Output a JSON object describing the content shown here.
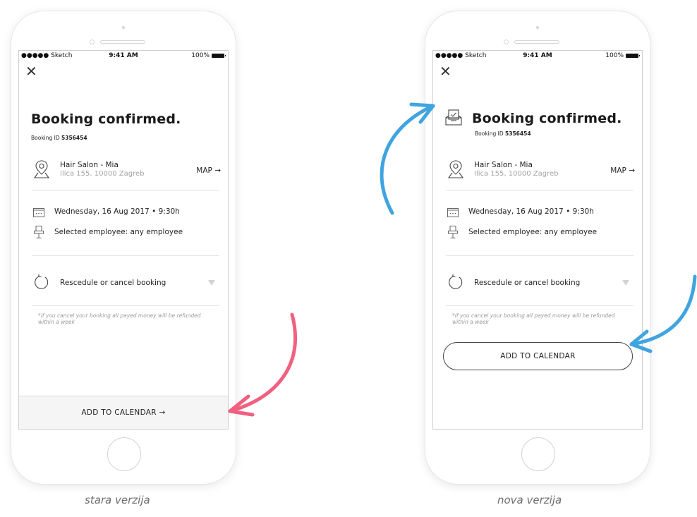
{
  "status_bar": {
    "carrier": "●●●●● Sketch",
    "time": "9:41 AM",
    "battery": "100%"
  },
  "old_version": {
    "title": "Booking confirmed.",
    "booking_id_label": "Booking ID",
    "booking_id": "5356454",
    "salon_name": "Hair Salon - Mia",
    "salon_address": "Ilica 155, 10000 Zagreb",
    "map_link": "MAP →",
    "date_time": "Wednesday, 16 Aug 2017 • 9:30h",
    "employee": "Selected employee: any employee",
    "reschedule": "Rescedule or cancel booking",
    "note": "*if you cancel your booking all payed money will be refunded within a week",
    "cta": "ADD TO CALENDAR →",
    "caption": "stara verzija"
  },
  "new_version": {
    "title": "Booking confirmed.",
    "booking_id_label": "Booking ID",
    "booking_id": "5356454",
    "salon_name": "Hair Salon - Mia",
    "salon_address": "Ilica 155, 10000 Zagreb",
    "map_link": "MAP →",
    "date_time": "Wednesday, 16 Aug 2017 • 9:30h",
    "employee": "Selected employee: any employee",
    "reschedule": "Rescedule or cancel booking",
    "note": "*if you cancel your booking all payed money will be refunded within a week",
    "cta": "ADD TO CALENDAR",
    "caption": "nova verzija"
  },
  "colors": {
    "old_arrow": "#f0607f",
    "new_arrow": "#3fa4e0"
  },
  "icons": {
    "close": "close-icon",
    "confirmed": "calendar-check-icon",
    "location": "location-pin-icon",
    "calendar": "calendar-icon",
    "employee": "chair-icon",
    "reschedule": "refresh-icon",
    "dropdown": "triangle-down-icon"
  }
}
